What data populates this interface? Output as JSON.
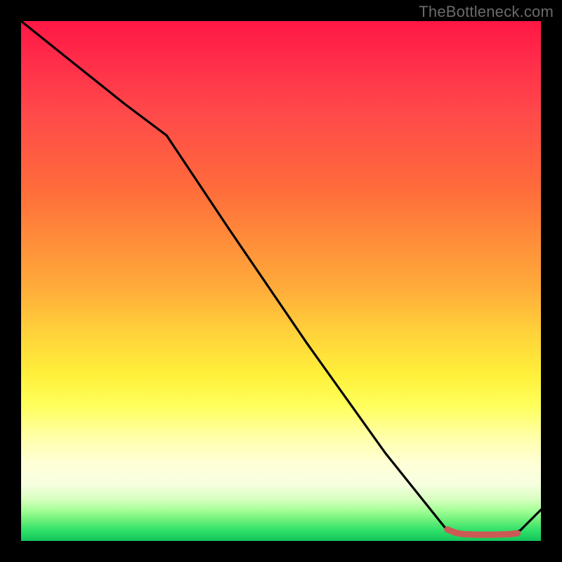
{
  "watermark": "TheBottleneck.com",
  "colors": {
    "background": "#000000",
    "watermark_text": "#6a6a6a",
    "line_primary": "#000000",
    "line_secondary": "#cc5a54",
    "gradient_top": "#ff1744",
    "gradient_bottom": "#14c35a"
  },
  "chart_data": {
    "type": "line",
    "title": "",
    "xlabel": "",
    "ylabel": "",
    "xlim": [
      0,
      100
    ],
    "ylim": [
      0,
      100
    ],
    "series": [
      {
        "name": "primary-curve",
        "color": "#000000",
        "x": [
          0,
          10,
          20,
          28,
          40,
          55,
          70,
          82,
          86,
          92,
          96,
          100
        ],
        "y": [
          100,
          92,
          84,
          78,
          60,
          38,
          17,
          2,
          1,
          1,
          2,
          6
        ]
      },
      {
        "name": "highlight-segment",
        "color": "#cc5a54",
        "x": [
          82,
          83.5,
          85,
          88,
          91,
          94,
          95.5
        ],
        "y": [
          2.2,
          1.6,
          1.3,
          1.2,
          1.2,
          1.3,
          1.5
        ]
      }
    ]
  }
}
